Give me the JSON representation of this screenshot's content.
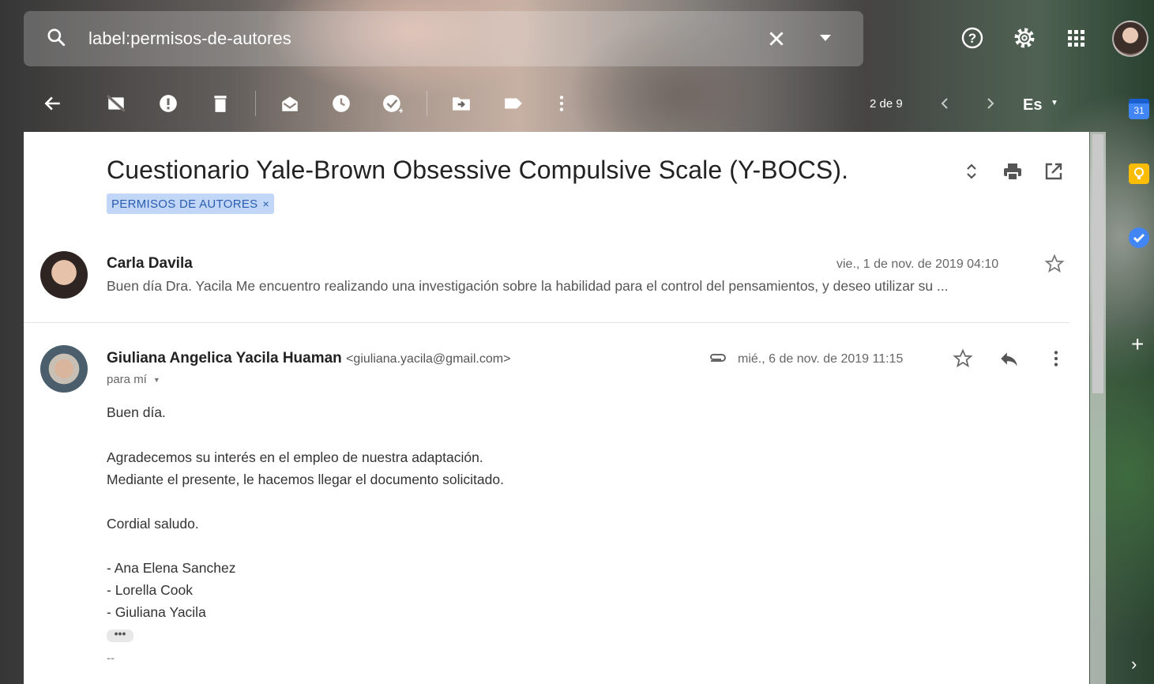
{
  "search": {
    "query": "label:permisos-de-autores"
  },
  "toolbar": {
    "pager": "2 de 9",
    "language": "Es"
  },
  "thread": {
    "subject": "Cuestionario Yale-Brown Obsessive Compulsive Scale (Y-BOCS).",
    "label_chip": "PERMISOS DE AUTORES",
    "label_chip_close": "×"
  },
  "messages": [
    {
      "sender": "Carla Davila",
      "date": "vie., 1 de nov. de 2019 04:10",
      "snippet": "Buen día Dra. Yacila Me encuentro realizando una investigación sobre la habilidad para el control del pensamientos, y deseo utilizar su ..."
    },
    {
      "sender": "Giuliana Angelica Yacila Huaman",
      "email": "<giuliana.yacila@gmail.com>",
      "date": "mié., 6 de nov. de 2019 11:15",
      "to": "para mí",
      "body": [
        "Buen día.",
        "Agradecemos su interés en el empleo de nuestra adaptación.",
        "Mediante el presente, le hacemos llegar el documento solicitado.",
        "Cordial saludo.",
        "- Ana Elena Sanchez",
        "- Lorella Cook",
        "- Giuliana Yacila"
      ],
      "trimmed": "•••",
      "signature_sep": "--"
    }
  ],
  "side_panel": {
    "calendar_day": "31",
    "add": "+",
    "expand": "›"
  },
  "colors": {
    "label_bg": "#c2d7f7",
    "label_text": "#2a5db0",
    "calendar": "#4285f4",
    "keep": "#fbbc04",
    "tasks": "#4285f4"
  }
}
